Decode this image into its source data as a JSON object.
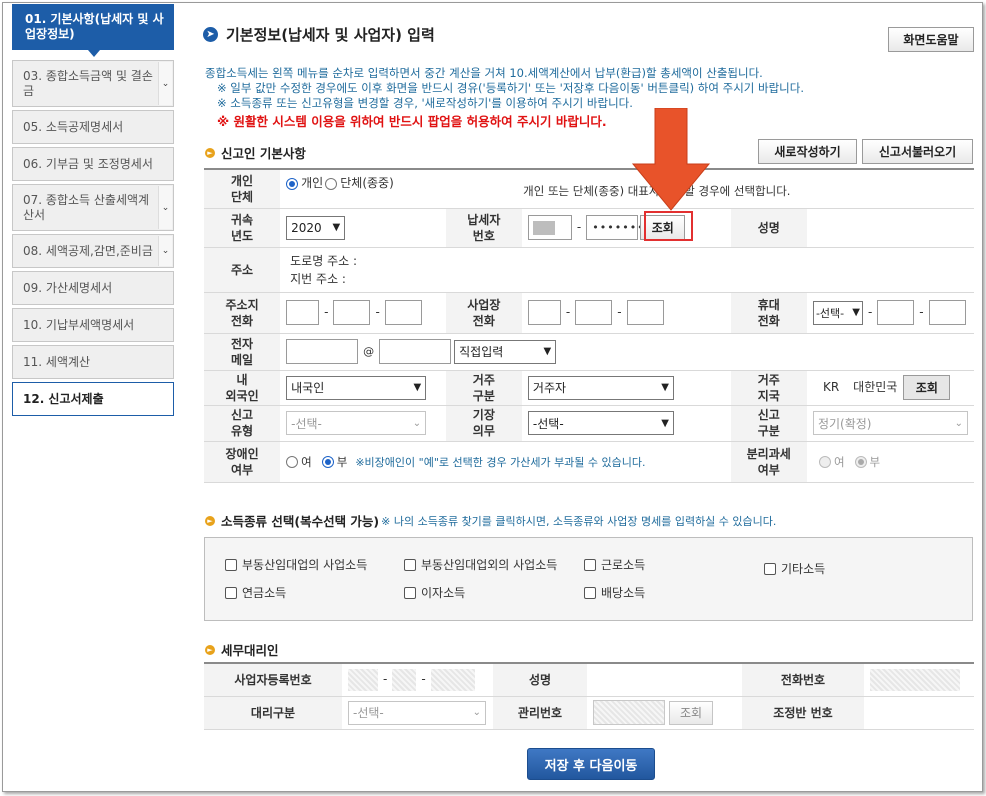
{
  "sidebar": {
    "items": [
      {
        "label": "01. 기본사항(납세자 및 사업장정보)"
      },
      {
        "label": "03. 종합소득금액 및 결손금"
      },
      {
        "label": "05. 소득공제명세서"
      },
      {
        "label": "06. 기부금 및 조정명세서"
      },
      {
        "label": "07. 종합소득 산출세액계산서"
      },
      {
        "label": "08. 세액공제,감면,준비금"
      },
      {
        "label": "09. 가산세명세서"
      },
      {
        "label": "10. 기납부세액명세서"
      },
      {
        "label": "11. 세액계산"
      },
      {
        "label": "12. 신고서제출"
      }
    ]
  },
  "header": {
    "title": "기본정보(납세자 및 사업자) 입력",
    "help_label": "화면도움말"
  },
  "notice": {
    "line1": "종합소득세는 왼쪽 메뉴를 순차로 입력하면서 중간 계산을 거쳐 10.세액계산에서 납부(환급)할 총세액이 산출됩니다.",
    "line2": "※ 일부 값만 수정한 경우에도 이후 화면을 반드시 경유('등록하기' 또는 '저장후 다음이동' 버튼클릭) 하여 주시기 바랍니다.",
    "line3": "※ 소득종류 또는 신고유형을 변경할 경우, '새로작성하기'를 이용하여 주시기 바랍니다.",
    "warning": "※ 원활한 시스템 이용을 위하여 반드시 팝업을 허용하여 주시기 바랍니다."
  },
  "reporter": {
    "section_title": "신고인 기본사항",
    "new_label": "새로작성하기",
    "load_label": "신고서불러오기",
    "labels": {
      "person_type": "개인\n단체",
      "year": "귀속\n년도",
      "taxpayer_no": "납세자\n번호",
      "name": "성명",
      "address": "주소",
      "address_phone": "주소지\n전화",
      "biz_phone": "사업장\n전화",
      "mobile": "휴대\n전화",
      "email": "전자\n메일",
      "nationality": "내\n외국인",
      "residence": "거주\n구분",
      "residence_country": "거주\n지국",
      "report_type": "신고\n유형",
      "bookkeeping": "기장\n의무",
      "report_class": "신고\n구분",
      "disabled": "장애인\n여부",
      "separate_tax": "분리과세\n여부"
    },
    "person_individual": "개인",
    "person_group": "단체(종중)",
    "person_note": "개인 또는 단체(종중) 대표자 신고할 경우에 선택합니다.",
    "year_value": "2020",
    "taxpayer_mask": "•••••••",
    "lookup_label": "조회",
    "road_address": "도로명 주소 :",
    "lot_address": "지번 주소 :",
    "mobile_select": "-선택-",
    "email_at": "@",
    "email_domain": "직접입력",
    "nationality_value": "내국인",
    "residence_value": "거주자",
    "country_code": "KR",
    "country_name": "대한민국",
    "report_type_value": "-선택-",
    "bookkeeping_value": "-선택-",
    "report_class_value": "정기(확정)",
    "yes": "여",
    "no": "부",
    "disabled_note": "※비장애인이 \"예\"로 선택한 경우 가산세가 부과될 수 있습니다."
  },
  "income_kinds": {
    "section_title": "소득종류 선택(복수선택 가능)",
    "section_note": "※ 나의 소득종류 찾기를 클릭하시면, 소득종류와 사업장 명세를 입력하실 수 있습니다.",
    "items": [
      {
        "label": "부동산임대업의 사업소득"
      },
      {
        "label": "부동산임대업외의 사업소득"
      },
      {
        "label": "근로소득"
      },
      {
        "label": "기타소득"
      },
      {
        "label": "연금소득"
      },
      {
        "label": "이자소득"
      },
      {
        "label": "배당소득"
      }
    ]
  },
  "agent": {
    "section_title": "세무대리인",
    "biz_reg_no": "사업자등록번호",
    "name": "성명",
    "phone": "전화번호",
    "agent_type": "대리구분",
    "agent_type_value": "-선택-",
    "mgmt_no": "관리번호",
    "lookup_label": "조회",
    "team_no": "조정반 번호"
  },
  "footer": {
    "save_label": "저장 후 다음이동"
  },
  "colors": {
    "primary": "#1d5da8",
    "notice": "#1f6b9c",
    "warning": "#e01212",
    "highlight_arrow": "#e8532a"
  }
}
